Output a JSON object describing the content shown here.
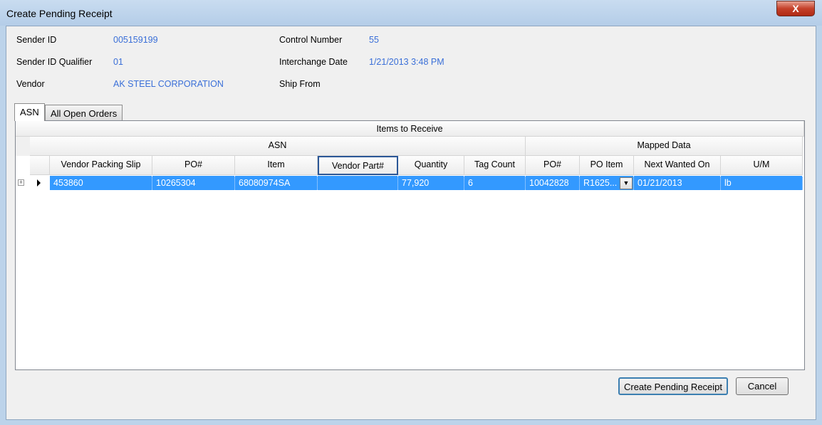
{
  "window": {
    "title": "Create Pending Receipt",
    "close_label": "X"
  },
  "fields": {
    "sender_id": {
      "label": "Sender ID",
      "value": "005159199"
    },
    "sender_id_qualifier": {
      "label": "Sender ID Qualifier",
      "value": "01"
    },
    "vendor": {
      "label": "Vendor",
      "value": "AK STEEL CORPORATION"
    },
    "control_number": {
      "label": "Control Number",
      "value": "55"
    },
    "interchange_date": {
      "label": "Interchange Date",
      "value": "1/21/2013 3:48 PM"
    },
    "ship_from": {
      "label": "Ship From",
      "value": ""
    }
  },
  "tabs": [
    {
      "label": "ASN",
      "active": true
    },
    {
      "label": "All Open Orders",
      "active": false
    }
  ],
  "grid": {
    "title": "Items to Receive",
    "groups": [
      "ASN",
      "Mapped Data"
    ],
    "columns": [
      "Vendor Packing Slip",
      "PO#",
      "Item",
      "Vendor Part#",
      "Quantity",
      "Tag Count",
      "PO#",
      "PO Item",
      "Next Wanted On",
      "U/M"
    ],
    "rows": [
      [
        "453860",
        "10265304",
        "68080974SA",
        "",
        "77,920",
        "6",
        "10042828",
        "R1625...",
        "01/21/2013",
        "lb"
      ]
    ],
    "selection_color": "#3399ff"
  },
  "buttons": {
    "create": "Create Pending Receipt",
    "cancel": "Cancel"
  }
}
